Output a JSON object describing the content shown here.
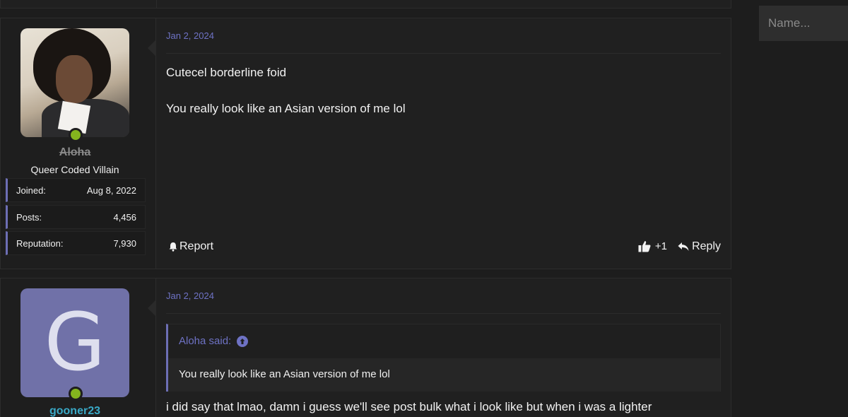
{
  "sidebar": {
    "name_placeholder": "Name..."
  },
  "posts": [
    {
      "date": "Jan 2, 2024",
      "username": "Aloha",
      "user_title": "Queer Coded Villain",
      "stats": [
        {
          "label": "Joined:",
          "value": "Aug 8, 2022"
        },
        {
          "label": "Posts:",
          "value": "4,456"
        },
        {
          "label": "Reputation:",
          "value": "7,930"
        }
      ],
      "body": [
        "Cutecel borderline foid",
        "You really look like an Asian version of me lol"
      ],
      "actions": {
        "report": "Report",
        "like_count": "+1",
        "reply": "Reply"
      }
    },
    {
      "date": "Jan 2, 2024",
      "avatar_letter": "G",
      "username": "gooner23",
      "quote": {
        "author": "Aloha said:",
        "text": "You really look like an Asian version of me lol"
      },
      "body": "i did say that lmao, damn i guess we'll see post bulk what i look like but when i was a lighter"
    }
  ],
  "colors": {
    "accent": "#6e72c4",
    "online": "#84b51e",
    "username_link": "#39a9c7"
  }
}
